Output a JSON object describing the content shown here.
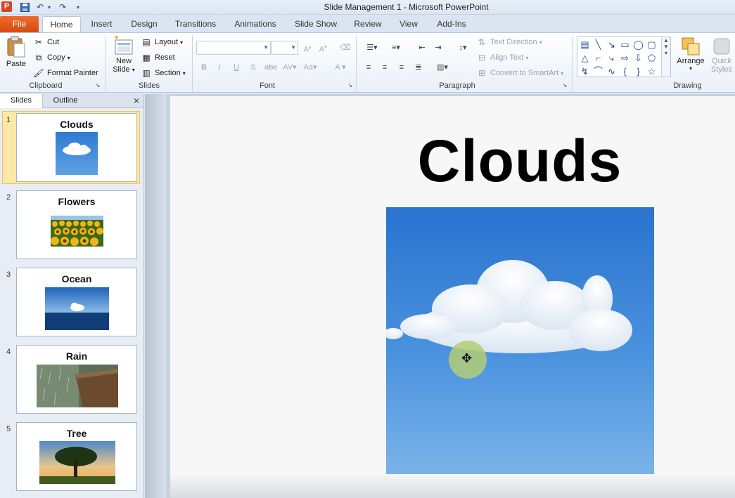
{
  "app": {
    "icon_letter": "P",
    "window_title": "Slide Management 1  -  Microsoft PowerPoint",
    "qat": [
      "save-icon",
      "undo-icon",
      "redo-icon",
      "customize-icon"
    ]
  },
  "tabs": [
    "File",
    "Home",
    "Insert",
    "Design",
    "Transitions",
    "Animations",
    "Slide Show",
    "Review",
    "View",
    "Add-Ins"
  ],
  "active_tab": "Home",
  "ribbon": {
    "clipboard": {
      "label": "Clipboard",
      "paste": "Paste",
      "cut": "Cut",
      "copy": "Copy",
      "format_painter": "Format Painter"
    },
    "slides": {
      "label": "Slides",
      "new_slide_line1": "New",
      "new_slide_line2": "Slide",
      "layout": "Layout",
      "reset": "Reset",
      "section": "Section"
    },
    "font": {
      "label": "Font",
      "font_name": "",
      "font_size": ""
    },
    "paragraph": {
      "label": "Paragraph",
      "text_direction": "Text Direction",
      "align_text": "Align Text",
      "convert_smartart": "Convert to SmartArt"
    },
    "drawing": {
      "label": "Drawing",
      "arrange": "Arrange",
      "quick_styles_line1": "Quick",
      "quick_styles_line2": "Styles"
    }
  },
  "panel": {
    "tab_slides": "Slides",
    "tab_outline": "Outline",
    "close_glyph": "×"
  },
  "slides": [
    {
      "num": "1",
      "title": "Clouds"
    },
    {
      "num": "2",
      "title": "Flowers"
    },
    {
      "num": "3",
      "title": "Ocean"
    },
    {
      "num": "4",
      "title": "Rain"
    },
    {
      "num": "5",
      "title": "Tree"
    }
  ],
  "selected_slide": 1,
  "current_slide": {
    "title": "Clouds"
  },
  "colors": {
    "accent_file": "#e25e1c",
    "selection": "#fde9a7",
    "sky": "#3f89d8"
  }
}
